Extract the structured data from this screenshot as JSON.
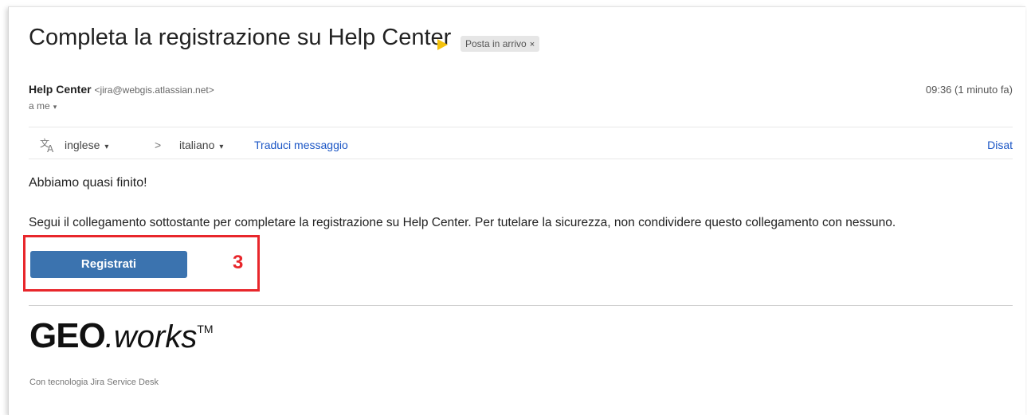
{
  "email": {
    "subject": "Completa la registrazione su Help Center",
    "label_chip": "Posta in arrivo",
    "label_close": "×",
    "sender_name": "Help Center",
    "sender_email": "<jira@webgis.atlassian.net>",
    "time": "09:36 (1 minuto fa)",
    "to": "a me",
    "to_caret": "▾"
  },
  "translate": {
    "icon": "translate-icon",
    "from_lang": "inglese",
    "to_lang": "italiano",
    "arrow": ">",
    "caret": "▾",
    "link": "Traduci messaggio",
    "disable": "Disat"
  },
  "content": {
    "greeting": "Abbiamo quasi finito!",
    "instructions": "Segui il collegamento sottostante per completare la registrazione su Help Center. Per tutelare la sicurezza, non condividere questo collegamento con nessuno.",
    "button_label": "Registrati",
    "step_number": "3"
  },
  "footer": {
    "logo_bold": "GEO",
    "logo_rest": ".works",
    "logo_tm": "TM",
    "powered_by": "Con tecnologia Jira Service Desk"
  },
  "colors": {
    "button": "#3b73af",
    "highlight": "#e8262b",
    "link": "#1a55c5",
    "importance": "#f4c20d"
  }
}
